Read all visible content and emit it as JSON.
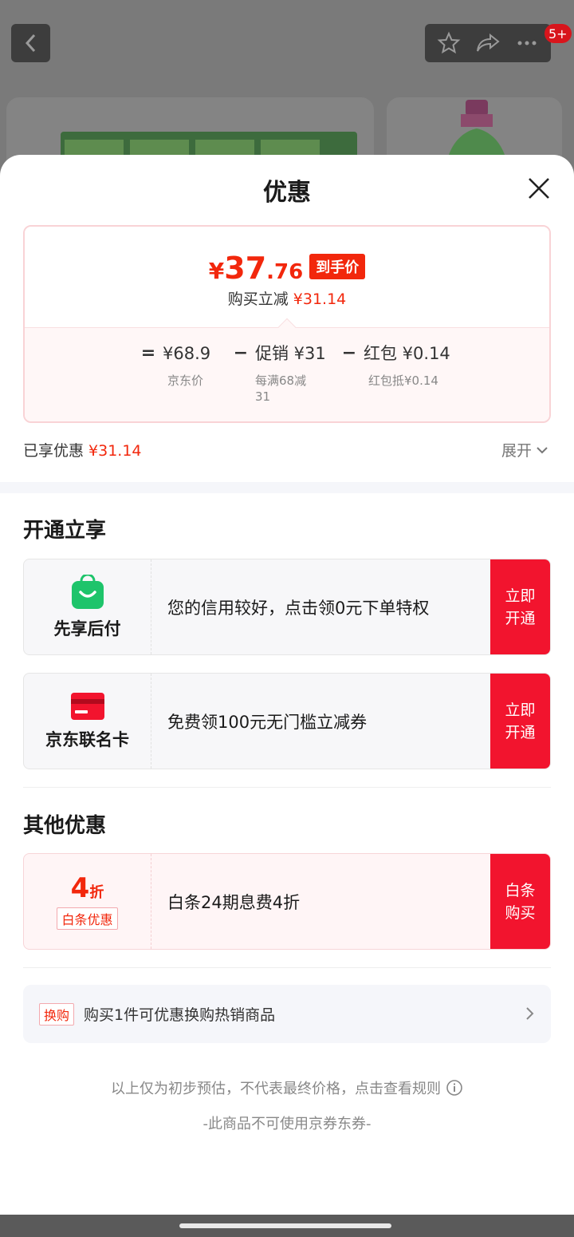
{
  "background": {
    "badge": "5+"
  },
  "sheet": {
    "title": "优惠"
  },
  "price": {
    "yen": "¥",
    "integer": "37",
    "decimal": ".76",
    "final_tag": "到手价",
    "reduce_label": "购买立减",
    "reduce_amount": "¥31.14",
    "formula": {
      "eq": "=",
      "jd_price": "¥68.9",
      "jd_price_label": "京东价",
      "minus1": "−",
      "promo": "促销 ¥31",
      "promo_label": "每满68减",
      "promo_label2": "31",
      "minus2": "−",
      "redpacket": "红包 ¥0.14",
      "redpacket_label": "红包抵¥0.14"
    }
  },
  "enjoyed": {
    "label": "已享优惠",
    "amount": "¥31.14",
    "expand_label": "展开"
  },
  "open_section": {
    "title": "开通立享",
    "offers": [
      {
        "name": "先享后付",
        "desc": "您的信用较好，点击领0元下单特权",
        "button": "立即开通"
      },
      {
        "name": "京东联名卡",
        "desc": "免费领100元无门槛立减券",
        "button": "立即开通"
      }
    ]
  },
  "other_section": {
    "title": "其他优惠",
    "offer": {
      "discount_num": "4",
      "discount_unit": "折",
      "tag": "白条优惠",
      "desc": "白条24期息费4折",
      "button": "白条购买"
    }
  },
  "swap": {
    "tag": "换购",
    "text": "购买1件可优惠换购热销商品"
  },
  "notes": {
    "line1": "以上仅为初步预估，不代表最终价格，点击查看规则",
    "line2": "-此商品不可使用京券东券-"
  },
  "colors": {
    "accent_red": "#f2270c",
    "button_red": "#f2142e",
    "app_green": "#1ec46b"
  }
}
